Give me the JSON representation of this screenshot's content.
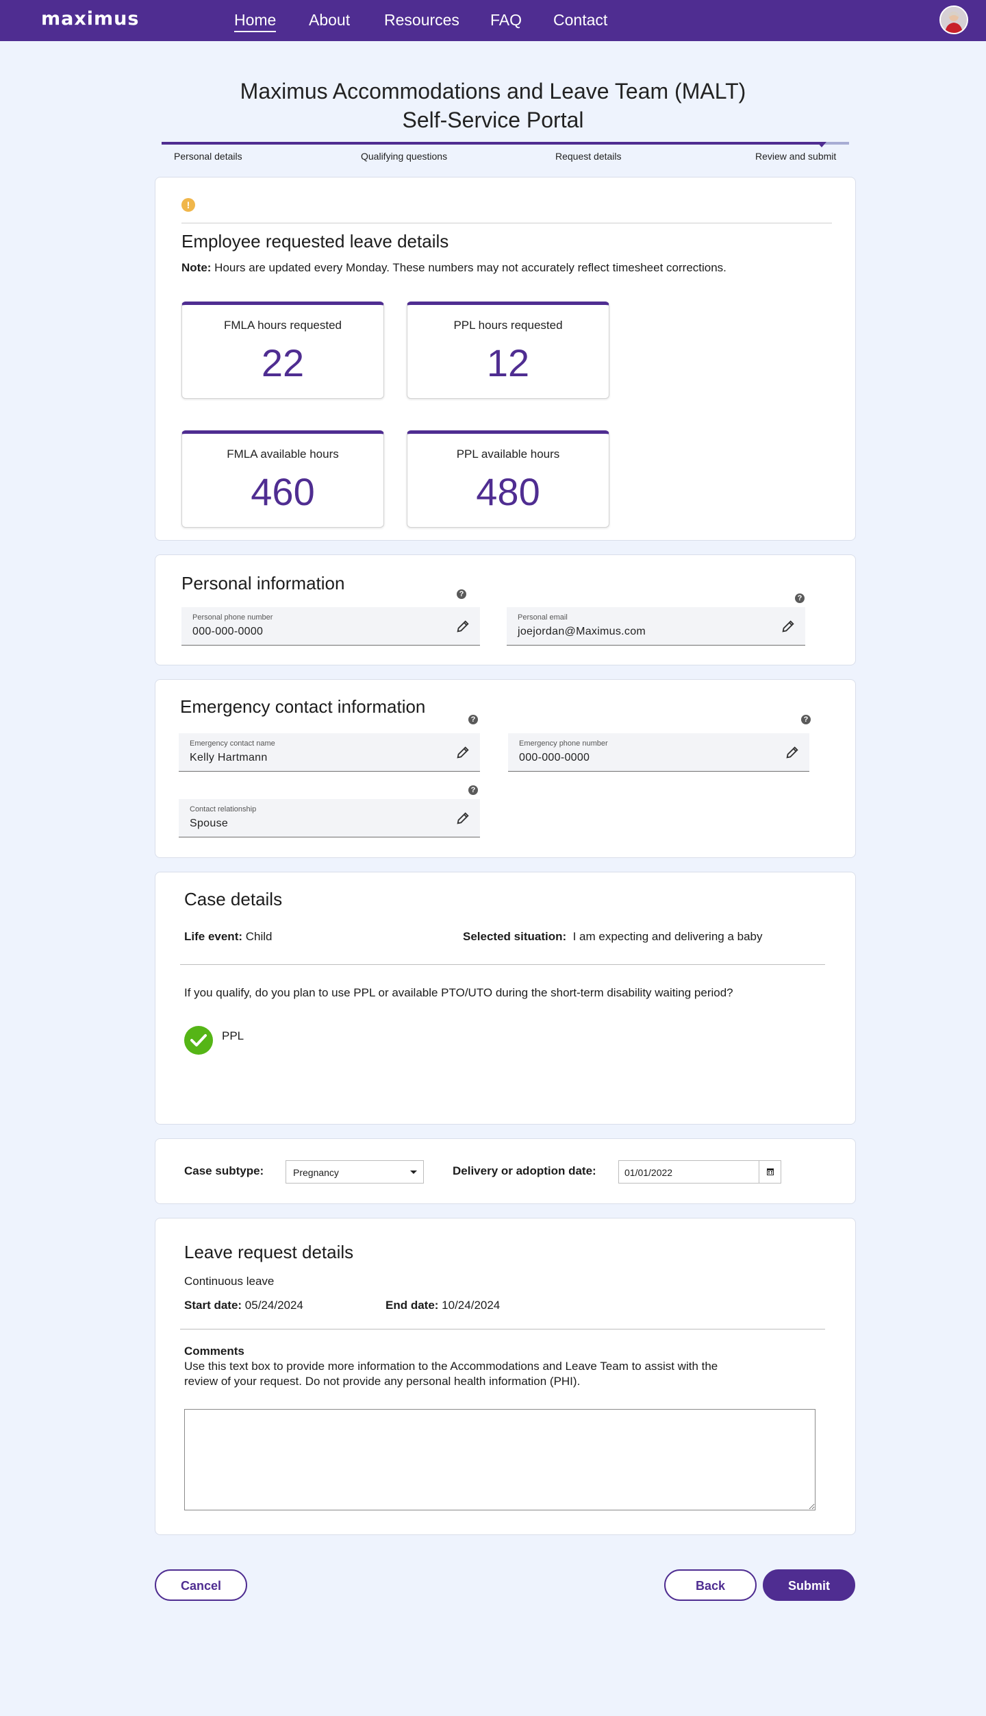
{
  "header": {
    "logo": "maximus",
    "nav": [
      "Home",
      "About",
      "Resources",
      "FAQ",
      "Contact"
    ]
  },
  "page": {
    "title_line1": "Maximus Accommodations and Leave Team (MALT)",
    "title_line2": "Self-Service Portal"
  },
  "stepper": {
    "steps": [
      "Personal details",
      "Qualifying questions",
      "Request details",
      "Review and submit"
    ],
    "progress_fraction": 0.96
  },
  "leave_details": {
    "title": "Employee requested leave details",
    "note_label": "Note:",
    "note_text": " Hours are updated every Monday. These numbers may not accurately reflect timesheet corrections.",
    "stats": [
      {
        "label": "FMLA hours requested",
        "value": "22"
      },
      {
        "label": "PPL hours requested",
        "value": "12"
      },
      {
        "label": "FMLA available hours",
        "value": "460"
      },
      {
        "label": "PPL available hours",
        "value": "480"
      }
    ]
  },
  "personal_info": {
    "title": "Personal information",
    "phone_label": "Personal phone number",
    "phone_value": "000-000-0000",
    "email_label": "Personal email",
    "email_value": "joejordan@Maximus.com"
  },
  "emergency": {
    "title": "Emergency contact information",
    "name_label": "Emergency contact name",
    "name_value": "Kelly Hartmann",
    "phone_label": "Emergency phone number",
    "phone_value": "000-000-0000",
    "relationship_label": "Contact relationship",
    "relationship_value": "Spouse"
  },
  "case_details": {
    "title": "Case details",
    "life_event_label": "Life event:",
    "life_event_value": " Child",
    "situation_label": "Selected situation:",
    "situation_value": "I am expecting and delivering a baby",
    "question": "If you qualify, do you plan to use PPL or available PTO/UTO during the short-term disability waiting period?",
    "answer": "PPL"
  },
  "case_subtype": {
    "subtype_label": "Case subtype:",
    "subtype_value": "Pregnancy",
    "date_label": "Delivery or adoption date:",
    "date_value": "01/01/2022"
  },
  "leave_request": {
    "title": "Leave request details",
    "type": "Continuous leave",
    "start_label": "Start date:",
    "start_value": " 05/24/2024",
    "end_label": "End date:",
    "end_value": " 10/24/2024",
    "comments_label": "Comments",
    "comments_help_line1": "Use this text box to provide more information to the Accommodations and Leave Team to assist with the",
    "comments_help_line2": "review of your request. Do not provide any personal health information (PHI).",
    "comments_value": ""
  },
  "actions": {
    "cancel": "Cancel",
    "back": "Back",
    "submit": "Submit"
  },
  "colors": {
    "brand": "#4f2d91",
    "background": "#eef3fd",
    "warning": "#f0b64a",
    "success": "#55b516"
  }
}
